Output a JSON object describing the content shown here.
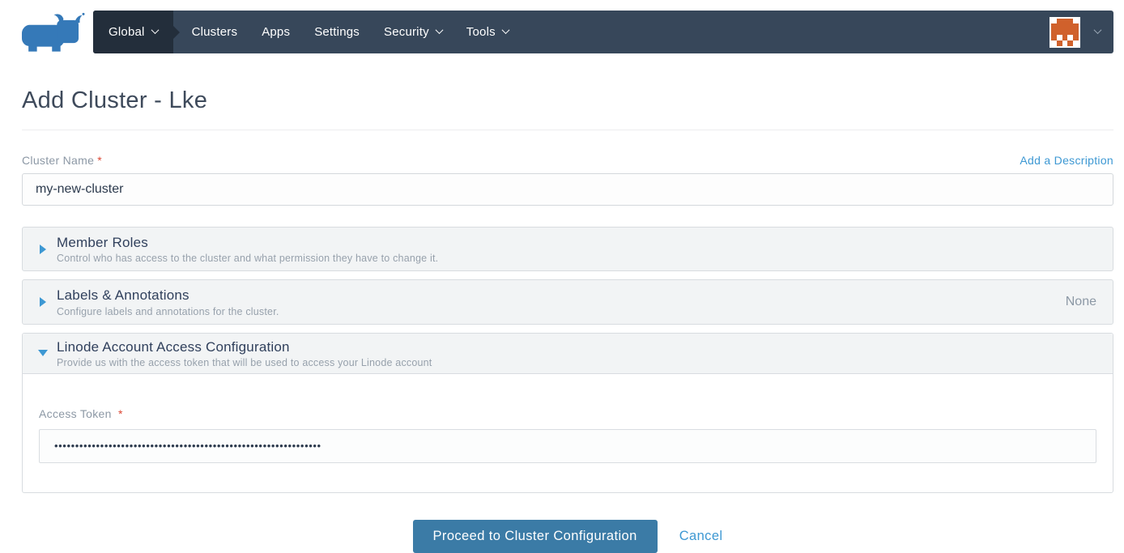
{
  "brand": {
    "logo": "rancher-cow-logo",
    "logo_color": "#3579b8"
  },
  "navbar": {
    "bg_color": "#37475a",
    "active_bg_color": "#232e3b",
    "items": [
      {
        "label": "Global",
        "has_dropdown": true,
        "active": true
      },
      {
        "label": "Clusters",
        "has_dropdown": false,
        "active": false
      },
      {
        "label": "Apps",
        "has_dropdown": false,
        "active": false
      },
      {
        "label": "Settings",
        "has_dropdown": false,
        "active": false
      },
      {
        "label": "Security",
        "has_dropdown": true,
        "active": false
      },
      {
        "label": "Tools",
        "has_dropdown": true,
        "active": false
      }
    ],
    "avatar": {
      "type": "identicon",
      "color": "#d0612c",
      "grid": [
        [
          0,
          1,
          1,
          1,
          0
        ],
        [
          1,
          1,
          1,
          1,
          1
        ],
        [
          1,
          1,
          1,
          1,
          1
        ],
        [
          1,
          0,
          1,
          0,
          1
        ],
        [
          0,
          1,
          0,
          1,
          0
        ]
      ]
    }
  },
  "page": {
    "title": "Add Cluster - Lke",
    "description_link": "Add a Description",
    "name_field": {
      "label": "Cluster Name",
      "required_marker": "*",
      "value": "my-new-cluster"
    },
    "sections": [
      {
        "title": "Member Roles",
        "subtitle": "Control who has access to the cluster and what permission they have to change it.",
        "expanded": false,
        "right_text": ""
      },
      {
        "title": "Labels & Annotations",
        "subtitle": "Configure labels and annotations for the cluster.",
        "expanded": false,
        "right_text": "None"
      },
      {
        "title": "Linode Account Access Configuration",
        "subtitle": "Provide us with the access token that will be used to access your Linode account",
        "expanded": true
      }
    ],
    "access_token_field": {
      "label": "Access Token",
      "required_marker": "*",
      "value_masked": "••••••••••••••••••••••••••••••••••••••••••••••••••••••••••••••••"
    },
    "actions": {
      "primary": "Proceed to Cluster Configuration",
      "cancel": "Cancel"
    }
  },
  "colors": {
    "link_blue": "#3d98d3",
    "button_blue": "#3b7ba6",
    "required_red": "#dc4835",
    "accordion_bg": "#f2f4f5",
    "border_gray": "#d8dce0",
    "title_slate": "#3e4a5b"
  }
}
